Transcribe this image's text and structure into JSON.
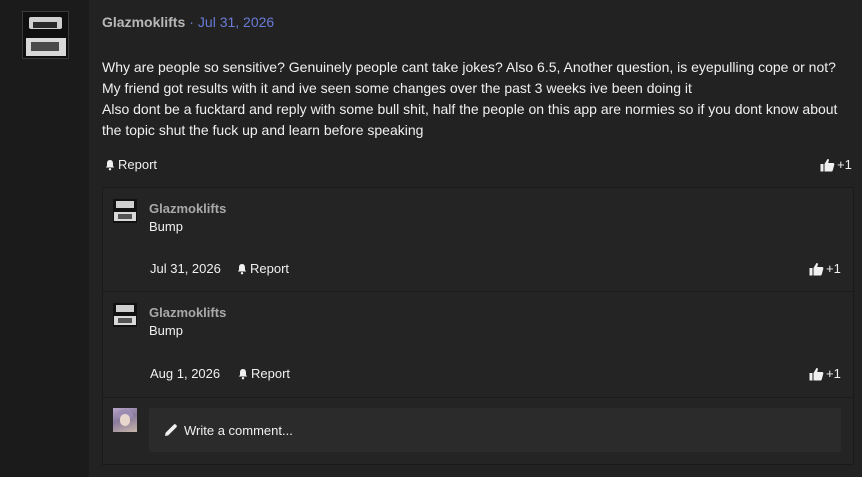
{
  "post": {
    "author": "Glazmoklifts",
    "separator": "·",
    "date": "Jul 31, 2026",
    "body_lines": [
      "Why are people so sensitive? Genuinely people cant take jokes? Also 6.5, Another question, is eyepulling cope or not? My friend got results with it and ive seen some changes over the past 3 weeks ive been doing it",
      "Also dont be a fucktard and reply with some bull shit, half the people on this app are normies so if you dont know about the topic shut the fuck up and learn before speaking"
    ],
    "report_label": "Report",
    "like_count": "+1"
  },
  "replies": [
    {
      "author": "Glazmoklifts",
      "text": "Bump",
      "date": "Jul 31, 2026",
      "report_label": "Report",
      "like_count": "+1"
    },
    {
      "author": "Glazmoklifts",
      "text": "Bump",
      "date": "Aug 1, 2026",
      "report_label": "Report",
      "like_count": "+1"
    }
  ],
  "comment_box": {
    "placeholder": "Write a comment...",
    "icon": "pencil-icon"
  },
  "icons": {
    "report": "bell-icon",
    "like": "thumbs-up-icon"
  },
  "colors": {
    "accent_date": "#6a7bd6",
    "background": "#1f1f1f",
    "text": "#f0f0f0"
  }
}
